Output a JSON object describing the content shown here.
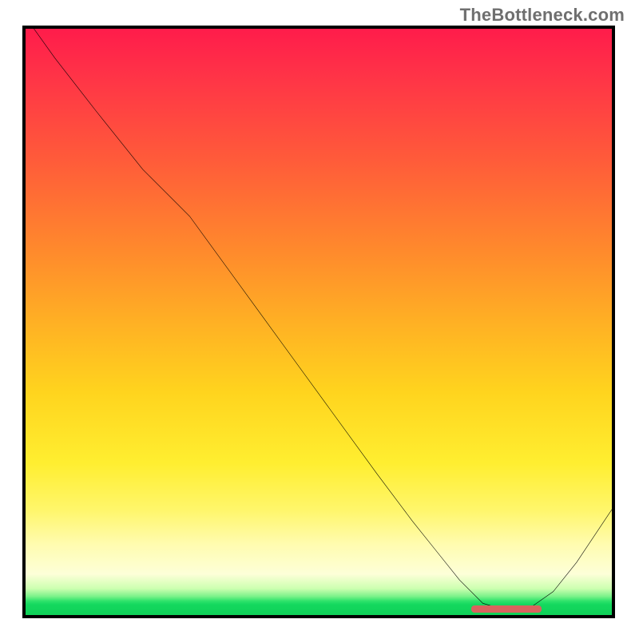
{
  "watermark": "TheBottleneck.com",
  "colors": {
    "border": "#000000",
    "curve": "#000000",
    "marker": "#d9635e",
    "gradient_top": "#ff1c4b",
    "gradient_bottom": "#0fd158"
  },
  "chart_data": {
    "type": "line",
    "title": "",
    "xlabel": "",
    "ylabel": "",
    "xlim": [
      0,
      100
    ],
    "ylim": [
      0,
      100
    ],
    "grid": false,
    "legend": false,
    "series": [
      {
        "name": "bottleneck-curve",
        "x": [
          0,
          5,
          12,
          20,
          28,
          36,
          44,
          52,
          60,
          66,
          70,
          74,
          78,
          82,
          86,
          90,
          94,
          100
        ],
        "y": [
          102,
          95,
          86,
          76,
          68,
          57,
          46,
          35,
          24,
          16,
          11,
          6,
          2,
          0.8,
          1.2,
          4,
          9,
          18
        ]
      }
    ],
    "annotations": [
      {
        "name": "optimal-range-marker",
        "x_start": 76,
        "x_end": 88,
        "y": 1.1
      }
    ]
  }
}
